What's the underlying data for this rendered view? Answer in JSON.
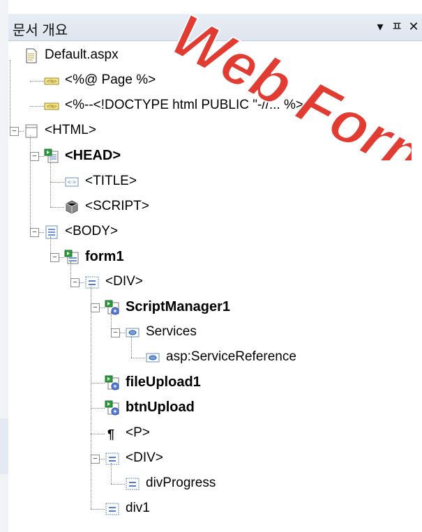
{
  "panel": {
    "title": "문서 개요",
    "buttons": [
      "▾",
      "ㅍ",
      "✕"
    ]
  },
  "watermark": {
    "text": "Web Form"
  },
  "tree": [
    {
      "label": "Default.aspx",
      "icon": "document-icon",
      "bold": false
    },
    {
      "label": "<%@ Page %>",
      "icon": "directive-icon",
      "bold": false
    },
    {
      "label": "<%--<!DOCTYPE html PUBLIC \"-//... %>",
      "icon": "directive-icon",
      "bold": false
    },
    {
      "label": "<HTML>",
      "icon": "html-element-icon",
      "bold": false
    },
    {
      "label": "<HEAD>",
      "icon": "server-head-icon",
      "bold": true
    },
    {
      "label": "<TITLE>",
      "icon": "title-tag-icon",
      "bold": false
    },
    {
      "label": "<SCRIPT>",
      "icon": "script-cube-icon",
      "bold": false
    },
    {
      "label": "<BODY>",
      "icon": "body-lines-icon",
      "bold": false
    },
    {
      "label": "form1",
      "icon": "server-form-icon",
      "bold": true
    },
    {
      "label": "<DIV>",
      "icon": "div-icon",
      "bold": false
    },
    {
      "label": "ScriptManager1",
      "icon": "server-control-icon",
      "bold": true
    },
    {
      "label": "Services",
      "icon": "service-icon",
      "bold": false
    },
    {
      "label": "asp:ServiceReference",
      "icon": "service-icon",
      "bold": false
    },
    {
      "label": "fileUpload1",
      "icon": "server-control-icon",
      "bold": true
    },
    {
      "label": "btnUpload",
      "icon": "server-control-icon",
      "bold": true
    },
    {
      "label": "<P>",
      "icon": "paragraph-icon",
      "bold": false
    },
    {
      "label": "<DIV>",
      "icon": "div-icon",
      "bold": false
    },
    {
      "label": "divProgress",
      "icon": "div-icon",
      "bold": false
    },
    {
      "label": "div1",
      "icon": "div-icon",
      "bold": false
    }
  ]
}
